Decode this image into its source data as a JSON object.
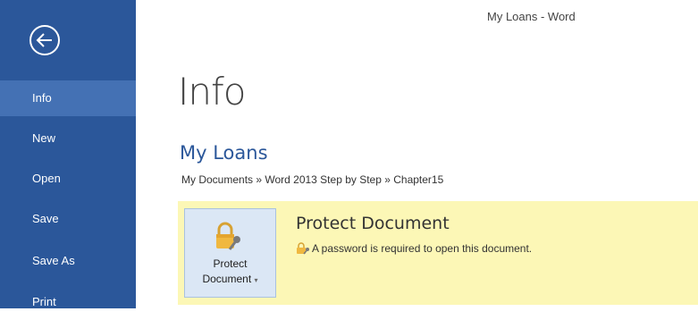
{
  "window": {
    "title": "My Loans - Word"
  },
  "sidebar": {
    "back_icon": "back-arrow-circle-icon",
    "items": [
      {
        "label": "Info",
        "active": true
      },
      {
        "label": "New",
        "active": false
      },
      {
        "label": "Open",
        "active": false
      },
      {
        "label": "Save",
        "active": false
      },
      {
        "label": "Save As",
        "active": false
      },
      {
        "label": "Print",
        "active": false
      }
    ]
  },
  "main": {
    "page_title": "Info",
    "document_name": "My Loans",
    "breadcrumb": "My Documents » Word 2013 Step by Step » Chapter15",
    "protect": {
      "button_line1": "Protect",
      "button_line2": "Document",
      "button_arrow": "▾",
      "heading": "Protect Document",
      "description": "A password is required to open this document.",
      "icon": "lock-key-icon"
    }
  },
  "colors": {
    "sidebar": "#2b579a",
    "sidebar_active": "#4471b4",
    "accent": "#2b579a",
    "protect_panel": "#fcf7b6"
  }
}
